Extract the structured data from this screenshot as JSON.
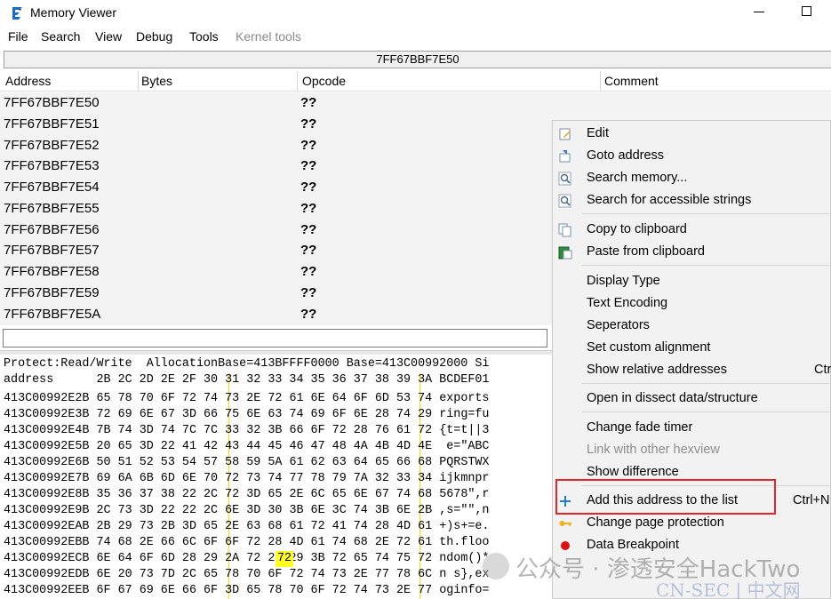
{
  "window": {
    "title": "Memory Viewer"
  },
  "menu": [
    "File",
    "Search",
    "View",
    "Debug",
    "Tools",
    "Kernel tools"
  ],
  "address_bar": "7FF67BBF7E50",
  "columns": [
    "Address",
    "Bytes",
    "Opcode",
    "Comment"
  ],
  "disasm_rows": [
    {
      "address": "7FF67BBF7E50",
      "opcode": "??"
    },
    {
      "address": "7FF67BBF7E51",
      "opcode": "??"
    },
    {
      "address": "7FF67BBF7E52",
      "opcode": "??"
    },
    {
      "address": "7FF67BBF7E53",
      "opcode": "??"
    },
    {
      "address": "7FF67BBF7E54",
      "opcode": "??"
    },
    {
      "address": "7FF67BBF7E55",
      "opcode": "??"
    },
    {
      "address": "7FF67BBF7E56",
      "opcode": "??"
    },
    {
      "address": "7FF67BBF7E57",
      "opcode": "??"
    },
    {
      "address": "7FF67BBF7E58",
      "opcode": "??"
    },
    {
      "address": "7FF67BBF7E59",
      "opcode": "??"
    },
    {
      "address": "7FF67BBF7E5A",
      "opcode": "??"
    }
  ],
  "hex_view": {
    "info": "Protect:Read/Write  AllocationBase=413BFFFF0000 Base=413C00992000 Si",
    "header": "address      2B 2C 2D 2E 2F 30 31 32 33 34 35 36 37 38 39 3A BCDEF01",
    "rows": [
      {
        "addr": "413C00992E2B",
        "bytes": "65 78 70 6F 72 74 73 2E 72 61 6E 64 6F 6D 53 74",
        "ascii": "exports"
      },
      {
        "addr": "413C00992E3B",
        "bytes": "72 69 6E 67 3D 66 75 6E 63 74 69 6F 6E 28 74 29",
        "ascii": "ring=fu"
      },
      {
        "addr": "413C00992E4B",
        "bytes": "7B 74 3D 74 7C 7C 33 32 3B 66 6F 72 28 76 61 72",
        "ascii": "{t=t||3"
      },
      {
        "addr": "413C00992E5B",
        "bytes": "20 65 3D 22 41 42 43 44 45 46 47 48 4A 4B 4D 4E",
        "ascii": " e=\"ABC"
      },
      {
        "addr": "413C00992E6B",
        "bytes": "50 51 52 53 54 57 58 59 5A 61 62 63 64 65 66 68",
        "ascii": "PQRSTWX"
      },
      {
        "addr": "413C00992E7B",
        "bytes": "69 6A 6B 6D 6E 70 72 73 74 77 78 79 7A 32 33 34",
        "ascii": "ijkmnpr"
      },
      {
        "addr": "413C00992E8B",
        "bytes": "35 36 37 38 22 2C 72 3D 65 2E 6C 65 6E 67 74 68",
        "ascii": "5678\",r"
      },
      {
        "addr": "413C00992E9B",
        "bytes": "2C 73 3D 22 22 2C 6E 3D 30 3B 6E 3C 74 3B 6E 2B",
        "ascii": ",s=\"\",n"
      },
      {
        "addr": "413C00992EAB",
        "bytes": "2B 29 73 2B 3D 65 2E 63 68 61 72 41 74 28 4D 61",
        "ascii": "+)s+=e."
      },
      {
        "addr": "413C00992EBB",
        "bytes": "74 68 2E 66 6C 6F 6F 72 28 4D 61 74 68 2E 72 61",
        "ascii": "th.floo"
      },
      {
        "addr": "413C00992ECB",
        "bytes": "6E 64 6F 6D 28 29 2A 72 29 29 3B 72 65 74 75 72",
        "ascii": "ndom()*"
      },
      {
        "addr": "413C00992EDB",
        "bytes": "6E 20 73 7D 2C 65 78 70 6F 72 74 73 2E 77 78 6C",
        "ascii": "n s},ex"
      },
      {
        "addr": "413C00992EEB",
        "bytes": "6F 67 69 6E 66 6F 3D 65 78 70 6F 72 74 73 2E 77",
        "ascii": "oginfo="
      }
    ],
    "highlight_byte": "72"
  },
  "context_menu": [
    {
      "label": "Edit",
      "icon": "edit-icon"
    },
    {
      "label": "Goto address",
      "icon": "goto-icon"
    },
    {
      "label": "Search memory...",
      "icon": "search-icon"
    },
    {
      "label": "Search for accessible strings",
      "icon": "search-icon"
    },
    {
      "label": "Copy to clipboard",
      "icon": "copy-icon"
    },
    {
      "label": "Paste from clipboard",
      "icon": "paste-icon"
    },
    {
      "label": "Display Type"
    },
    {
      "label": "Text Encoding"
    },
    {
      "label": "Seperators"
    },
    {
      "label": "Set custom alignment"
    },
    {
      "label": "Show relative addresses",
      "shortcut": "Ctr"
    },
    {
      "label": "Open in dissect data/structure"
    },
    {
      "label": "Change fade timer"
    },
    {
      "label": "Link with other hexview",
      "disabled": true
    },
    {
      "label": "Show difference"
    },
    {
      "label": "Add this address to the list",
      "shortcut": "Ctrl+N",
      "icon": "plus-icon"
    },
    {
      "label": "Change page protection",
      "icon": "key-icon"
    },
    {
      "label": "Data Breakpoint",
      "icon": "breakpoint-icon"
    }
  ],
  "watermark": {
    "text": "公众号 · 渗透安全HackTwo",
    "sub": "CN-SEC | 中文网"
  },
  "colors": {
    "highlight_box": "#e3242b",
    "hex_highlight": "#ffff20",
    "disasm_bg": "#f3f3f3"
  }
}
